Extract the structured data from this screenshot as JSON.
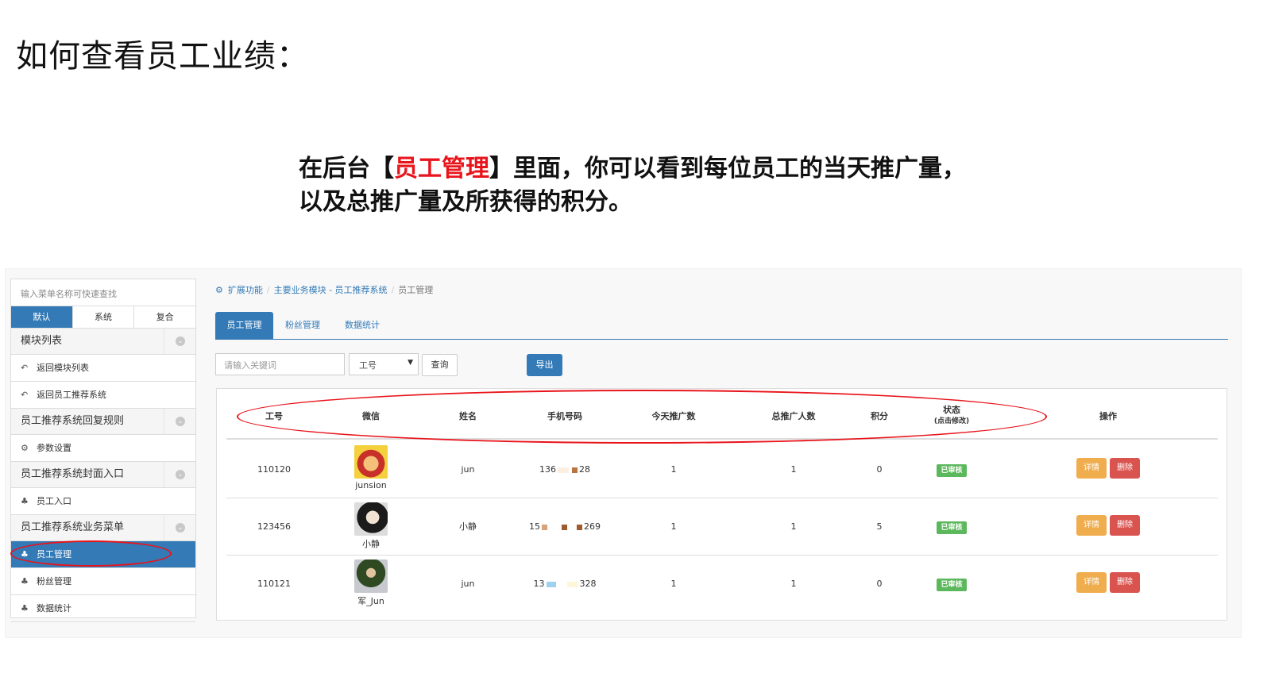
{
  "slide": {
    "title": "如何查看员工业绩：",
    "caption_prefix": "在后台【",
    "caption_highlight": "员工管理",
    "caption_suffix": "】里面，你可以看到每位员工的当天推广量，",
    "caption_line2": "以及总推广量及所获得的积分。",
    "highlight_color": "#e8141b"
  },
  "sidebar": {
    "search_placeholder": "输入菜单名称可快速查找",
    "tabs": [
      "默认",
      "系统",
      "复合"
    ],
    "groups": [
      {
        "label": "模块列表",
        "items": [
          {
            "icon": "reply-icon",
            "glyph": "↶",
            "label": "返回模块列表"
          },
          {
            "icon": "reply-icon",
            "glyph": "↶",
            "label": "返回员工推荐系统"
          }
        ]
      },
      {
        "label": "员工推荐系统回复规则",
        "items": [
          {
            "icon": "gear-icon",
            "glyph": "⚙",
            "label": "参数设置"
          }
        ]
      },
      {
        "label": "员工推荐系统封面入口",
        "items": [
          {
            "icon": "sitemap-icon",
            "glyph": "♣",
            "label": "员工入口"
          }
        ]
      },
      {
        "label": "员工推荐系统业务菜单",
        "items": [
          {
            "icon": "sitemap-icon",
            "glyph": "♣",
            "label": "员工管理",
            "active": true
          },
          {
            "icon": "sitemap-icon",
            "glyph": "♣",
            "label": "粉丝管理"
          },
          {
            "icon": "sitemap-icon",
            "glyph": "♣",
            "label": "数据统计"
          }
        ]
      }
    ]
  },
  "breadcrumb": {
    "items": [
      "扩展功能",
      "主要业务模块 - 员工推荐系统"
    ],
    "current": "员工管理"
  },
  "tabs": [
    "员工管理",
    "粉丝管理",
    "数据统计"
  ],
  "toolbar": {
    "search_placeholder": "请输入关键词",
    "select_value": "工号",
    "query_label": "查询",
    "export_label": "导出"
  },
  "table": {
    "headers": {
      "id": "工号",
      "wechat": "微信",
      "name": "姓名",
      "phone": "手机号码",
      "today": "今天推广数",
      "total": "总推广人数",
      "points": "积分",
      "status": "状态",
      "status_note": "(点击修改)",
      "actions": "操作"
    },
    "rows": [
      {
        "id": "110120",
        "wechat": "junsion",
        "name": "jun",
        "phone_start": "136",
        "phone_end": "28",
        "today": "1",
        "total": "1",
        "points": "0",
        "status": "已审核",
        "detail": "详情",
        "delete": "删除"
      },
      {
        "id": "123456",
        "wechat": "小静",
        "name": "小静",
        "phone_start": "15",
        "phone_end": "269",
        "today": "1",
        "total": "1",
        "points": "5",
        "status": "已审核",
        "detail": "详情",
        "delete": "删除"
      },
      {
        "id": "110121",
        "wechat": "军_Jun",
        "name": "jun",
        "phone_start": "13",
        "phone_end": "328",
        "today": "1",
        "total": "1",
        "points": "0",
        "status": "已审核",
        "detail": "详情",
        "delete": "删除"
      }
    ]
  },
  "colors": {
    "primary": "#337ab7",
    "success": "#5cb85c",
    "warning": "#f0ad4e",
    "danger": "#d9534f",
    "annotation": "#e8141b"
  }
}
